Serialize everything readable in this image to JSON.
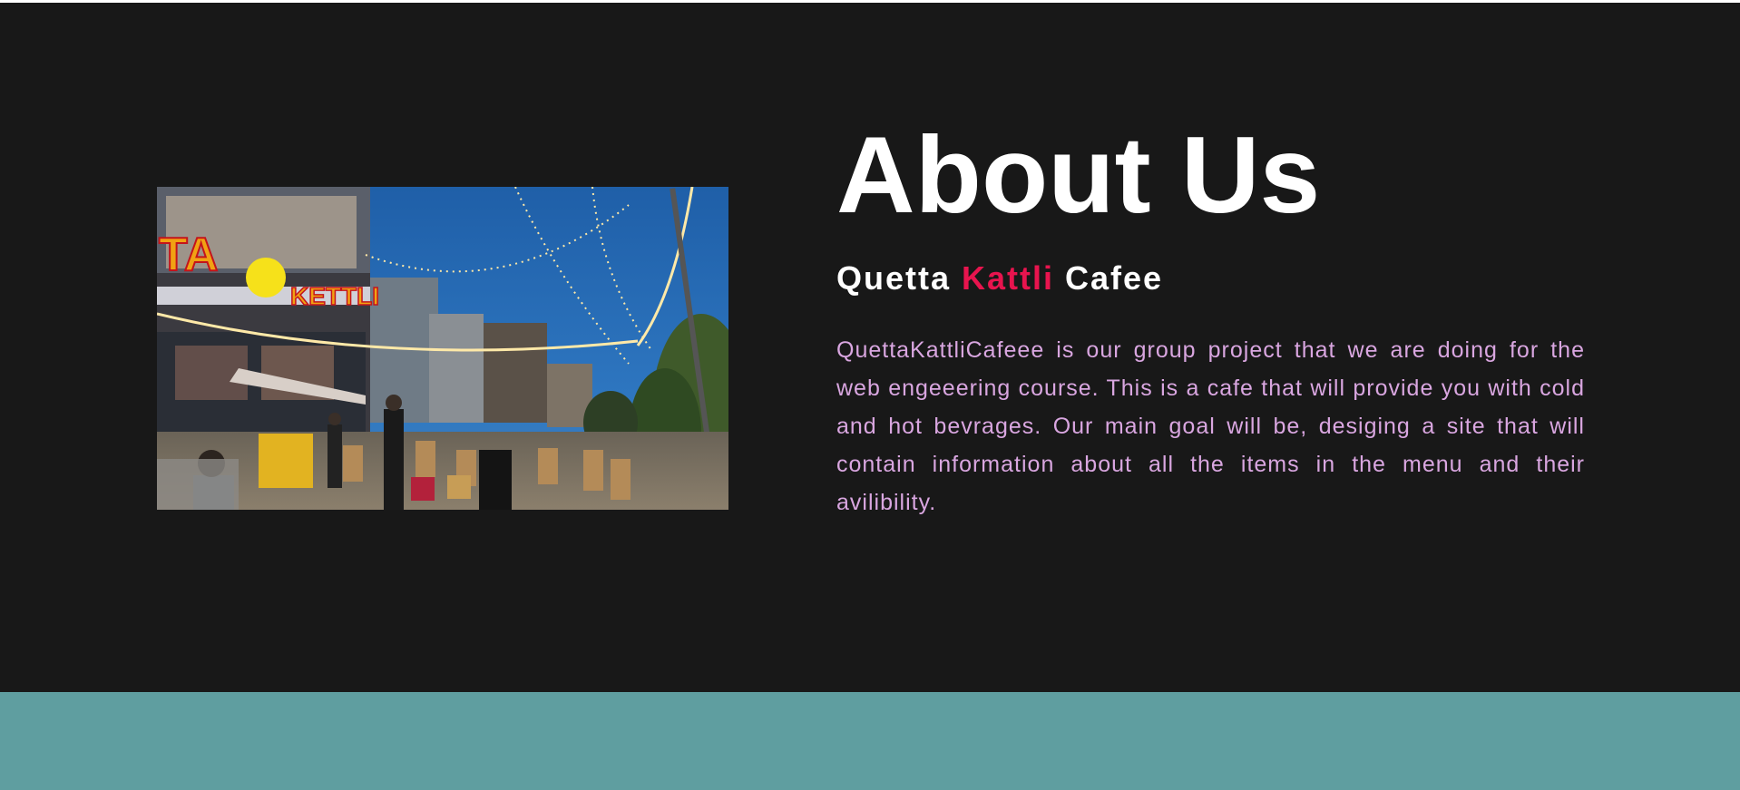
{
  "about": {
    "title": "About Us",
    "subtitle_part1": "Quetta ",
    "subtitle_accent": "Kattli",
    "subtitle_part2": " Cafee",
    "description": "QuettaKattliCafeee is our group project that we are doing for the web engeeering course. This is a cafe that will provide you with cold and hot bevrages. Our main goal will be, desiging a site that will contain information about all the items in the menu and their avilibility.",
    "image": {
      "sign_text_left": "TA",
      "sign_text_right": "KETTLI",
      "icon": "cafe-photo"
    }
  },
  "colors": {
    "background": "#181818",
    "title": "#ffffff",
    "accent": "#e8144e",
    "description": "#d9a6e0",
    "footer_band": "#5f9ea0"
  }
}
